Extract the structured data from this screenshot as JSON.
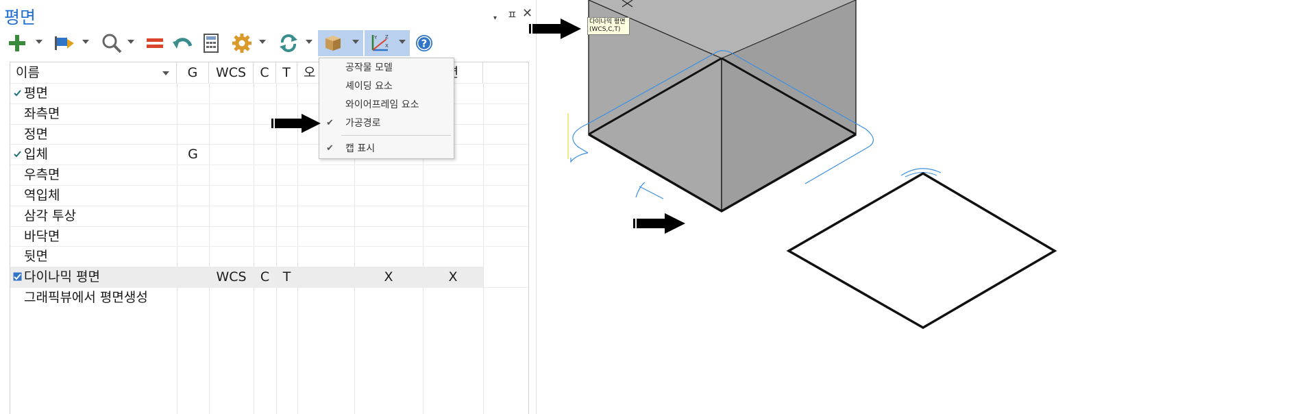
{
  "panel": {
    "title": "평면",
    "controls": {
      "pin_menu": "▾",
      "pin": "ㅍ",
      "close": "✕"
    }
  },
  "toolbar": {
    "items": [
      {
        "icon": "plus-icon",
        "has_dropdown": true
      },
      {
        "icon": "flag-icon",
        "has_dropdown": true
      },
      {
        "icon": "magnifier-icon",
        "has_dropdown": true
      },
      {
        "icon": "equal-icon",
        "has_dropdown": false
      },
      {
        "icon": "undo-icon",
        "has_dropdown": false
      },
      {
        "icon": "calculator-icon",
        "has_dropdown": false
      },
      {
        "icon": "gear-icon",
        "has_dropdown": true
      },
      {
        "icon": "refresh-icon",
        "has_dropdown": true
      },
      {
        "icon": "stock-model-icon",
        "has_dropdown": true,
        "active": true
      },
      {
        "icon": "axis-icon",
        "has_dropdown": true,
        "active": true
      },
      {
        "icon": "help-icon",
        "has_dropdown": false
      }
    ],
    "accent": "#2f74c7"
  },
  "table": {
    "columns": [
      "이름",
      "G",
      "WCS",
      "C",
      "T",
      "오",
      "션"
    ],
    "rows": [
      {
        "name": "평면",
        "checked": true,
        "g": "",
        "wcs": "",
        "c": "",
        "t": "",
        "x1": "",
        "x2": ""
      },
      {
        "name": "좌측면",
        "checked": false,
        "g": "",
        "wcs": "",
        "c": "",
        "t": "",
        "x1": "",
        "x2": ""
      },
      {
        "name": "정면",
        "checked": false,
        "g": "",
        "wcs": "",
        "c": "",
        "t": "",
        "x1": "",
        "x2": ""
      },
      {
        "name": "입체",
        "checked": true,
        "g": "G",
        "wcs": "",
        "c": "",
        "t": "",
        "x1": "",
        "x2": ""
      },
      {
        "name": "우측면",
        "checked": false,
        "g": "",
        "wcs": "",
        "c": "",
        "t": "",
        "x1": "",
        "x2": ""
      },
      {
        "name": "역입체",
        "checked": false,
        "g": "",
        "wcs": "",
        "c": "",
        "t": "",
        "x1": "",
        "x2": ""
      },
      {
        "name": "삼각 투상",
        "checked": false,
        "g": "",
        "wcs": "",
        "c": "",
        "t": "",
        "x1": "",
        "x2": ""
      },
      {
        "name": "바닥면",
        "checked": false,
        "g": "",
        "wcs": "",
        "c": "",
        "t": "",
        "x1": "",
        "x2": ""
      },
      {
        "name": "뒷면",
        "checked": false,
        "g": "",
        "wcs": "",
        "c": "",
        "t": "",
        "x1": "",
        "x2": ""
      },
      {
        "name": "다이나믹 평면",
        "checked": true,
        "selected": true,
        "g": "",
        "wcs": "WCS",
        "c": "C",
        "t": "T",
        "x1": "X",
        "x2": "X"
      },
      {
        "name": "그래픽뷰에서 평면생성",
        "checked": false,
        "g": "",
        "wcs": "",
        "c": "",
        "t": "",
        "x1": "",
        "x2": ""
      }
    ]
  },
  "menu": {
    "items": [
      {
        "label": "공작물 모델",
        "checked": false
      },
      {
        "label": "셰이딩 요소",
        "checked": false
      },
      {
        "label": "와이어프레임 요소",
        "checked": false
      },
      {
        "label": "가공경로",
        "checked": true
      },
      {
        "label": "캡 표시",
        "checked": true
      }
    ],
    "tick": "✔"
  },
  "viewport": {
    "tooltip": {
      "line1": "다이나믹 평면",
      "line2": "(WCS,C,T)"
    }
  }
}
